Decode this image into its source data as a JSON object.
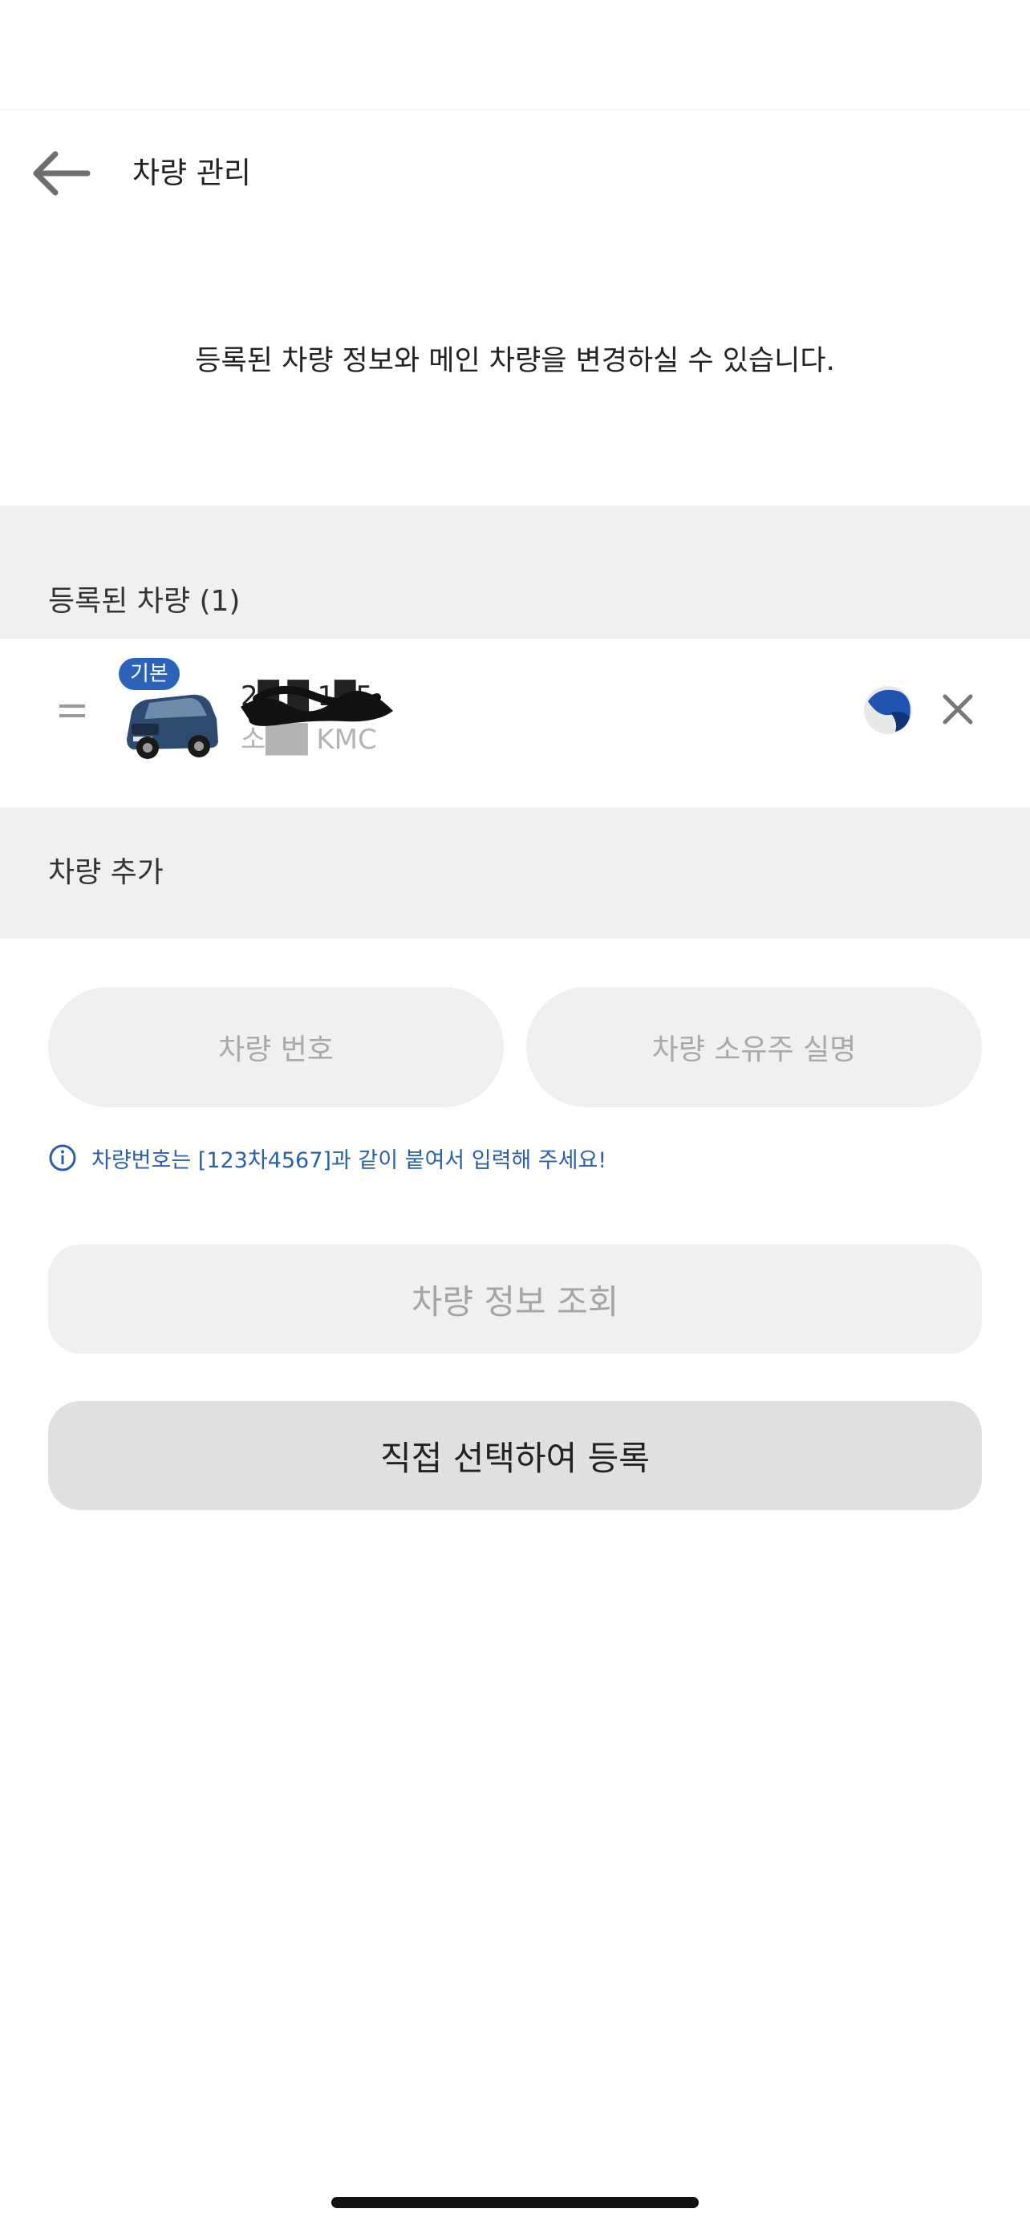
{
  "header": {
    "title": "차량 관리",
    "back_icon": "arrow-left-icon"
  },
  "description": "등록된 차량 정보와 메인 차량을 변경하실 수 있습니다.",
  "registered": {
    "section_label": "등록된 차량 (1)",
    "vehicles": [
      {
        "badge": "기본",
        "plate_number": "2█ █ 1█5",
        "model": "소██ KMC",
        "drag_icon": "drag-handle-icon",
        "insurer_icon": "insurer-logo-icon",
        "delete_icon": "close-icon"
      }
    ]
  },
  "add_vehicle": {
    "section_label": "차량 추가",
    "plate_input_placeholder": "차량 번호",
    "owner_input_placeholder": "차량 소유주 실명",
    "hint_icon": "info-icon",
    "hint": "차량번호는 [123차4567]과 같이 붙여서 입력해 주세요!",
    "lookup_button": "차량 정보 조회",
    "manual_button": "직접 선택하여 등록"
  },
  "colors": {
    "accent": "#2b63ba",
    "section_bg": "#f0f0f0",
    "hint_text": "#2b5faa"
  }
}
